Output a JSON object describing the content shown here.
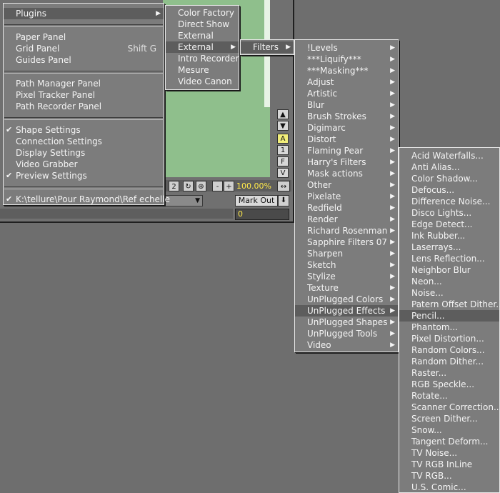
{
  "background": {
    "view_buttons": [
      "A",
      "1",
      "F",
      "V"
    ],
    "transport": {
      "frame_label": "2",
      "zoom": "100.00%"
    },
    "combo_value": "0",
    "mark_out_label": "Mark Out",
    "time_value": "0"
  },
  "main_menu": {
    "groups": [
      [
        {
          "label": "Plugins",
          "submenu": true,
          "highlighted": true
        }
      ],
      [
        {
          "label": "Paper Panel"
        },
        {
          "label": "Grid Panel",
          "shortcut": "Shift G"
        },
        {
          "label": "Guides Panel"
        }
      ],
      [
        {
          "label": "Path Manager Panel"
        },
        {
          "label": "Pixel Tracker Panel"
        },
        {
          "label": "Path Recorder Panel"
        }
      ],
      [
        {
          "label": "Shape Settings",
          "checked": true
        },
        {
          "label": "Connection Settings"
        },
        {
          "label": "Display Settings"
        },
        {
          "label": "Video Grabber"
        },
        {
          "label": "Preview Settings",
          "checked": true
        }
      ],
      [
        {
          "label": "K:\\tellure\\Pour Raymond\\Ref echelle",
          "checked": true
        }
      ]
    ]
  },
  "plugins_menu": {
    "items": [
      {
        "label": "Color Factory"
      },
      {
        "label": "Direct Show"
      },
      {
        "label": "External"
      },
      {
        "label": "External",
        "submenu": true,
        "highlighted": true
      },
      {
        "label": "Intro Recorder"
      },
      {
        "label": "Mesure"
      },
      {
        "label": "Video Canon"
      }
    ]
  },
  "external_menu": {
    "items": [
      {
        "label": "Filters",
        "submenu": true,
        "highlighted": true
      }
    ]
  },
  "filters_menu": {
    "items": [
      {
        "label": "!Levels",
        "submenu": true
      },
      {
        "label": "***Liquify***",
        "submenu": true
      },
      {
        "label": "***Masking***",
        "submenu": true
      },
      {
        "label": "Adjust",
        "submenu": true
      },
      {
        "label": "Artistic",
        "submenu": true
      },
      {
        "label": "Blur",
        "submenu": true
      },
      {
        "label": "Brush Strokes",
        "submenu": true
      },
      {
        "label": "Digimarc",
        "submenu": true
      },
      {
        "label": "Distort",
        "submenu": true
      },
      {
        "label": "Flaming Pear",
        "submenu": true
      },
      {
        "label": "Harry's Filters",
        "submenu": true
      },
      {
        "label": "Mask actions",
        "submenu": true
      },
      {
        "label": "Other",
        "submenu": true
      },
      {
        "label": "Pixelate",
        "submenu": true
      },
      {
        "label": "Redfield",
        "submenu": true
      },
      {
        "label": "Render",
        "submenu": true
      },
      {
        "label": "Richard Rosenman",
        "submenu": true
      },
      {
        "label": "Sapphire Filters 07",
        "submenu": true
      },
      {
        "label": "Sharpen",
        "submenu": true
      },
      {
        "label": "Sketch",
        "submenu": true
      },
      {
        "label": "Stylize",
        "submenu": true
      },
      {
        "label": "Texture",
        "submenu": true
      },
      {
        "label": "UnPlugged Colors",
        "submenu": true
      },
      {
        "label": "UnPlugged Effects",
        "submenu": true,
        "highlighted": true
      },
      {
        "label": "UnPlugged Shapes",
        "submenu": true
      },
      {
        "label": "UnPlugged Tools",
        "submenu": true
      },
      {
        "label": "Video",
        "submenu": true
      }
    ]
  },
  "effects_menu": {
    "items": [
      {
        "label": "Acid Waterfalls..."
      },
      {
        "label": "Anti Alias..."
      },
      {
        "label": "Color Shadow..."
      },
      {
        "label": "Defocus..."
      },
      {
        "label": "Difference Noise..."
      },
      {
        "label": "Disco Lights..."
      },
      {
        "label": "Edge Detect..."
      },
      {
        "label": "Ink Rubber..."
      },
      {
        "label": "Laserrays..."
      },
      {
        "label": "Lens Reflection..."
      },
      {
        "label": "Neighbor Blur"
      },
      {
        "label": "Neon..."
      },
      {
        "label": "Noise..."
      },
      {
        "label": "Patern Offset Dither..."
      },
      {
        "label": "Pencil...",
        "highlighted": true
      },
      {
        "label": "Phantom..."
      },
      {
        "label": "Pixel Distortion..."
      },
      {
        "label": "Random Colors..."
      },
      {
        "label": "Random Dither..."
      },
      {
        "label": "Raster..."
      },
      {
        "label": "RGB Speckle..."
      },
      {
        "label": "Rotate..."
      },
      {
        "label": "Scanner Correction..."
      },
      {
        "label": "Screen Dither..."
      },
      {
        "label": "Snow..."
      },
      {
        "label": "Tangent Deform..."
      },
      {
        "label": "TV Noise..."
      },
      {
        "label": "TV RGB InLine"
      },
      {
        "label": "TV RGB..."
      },
      {
        "label": "U.S. Comic..."
      }
    ]
  }
}
